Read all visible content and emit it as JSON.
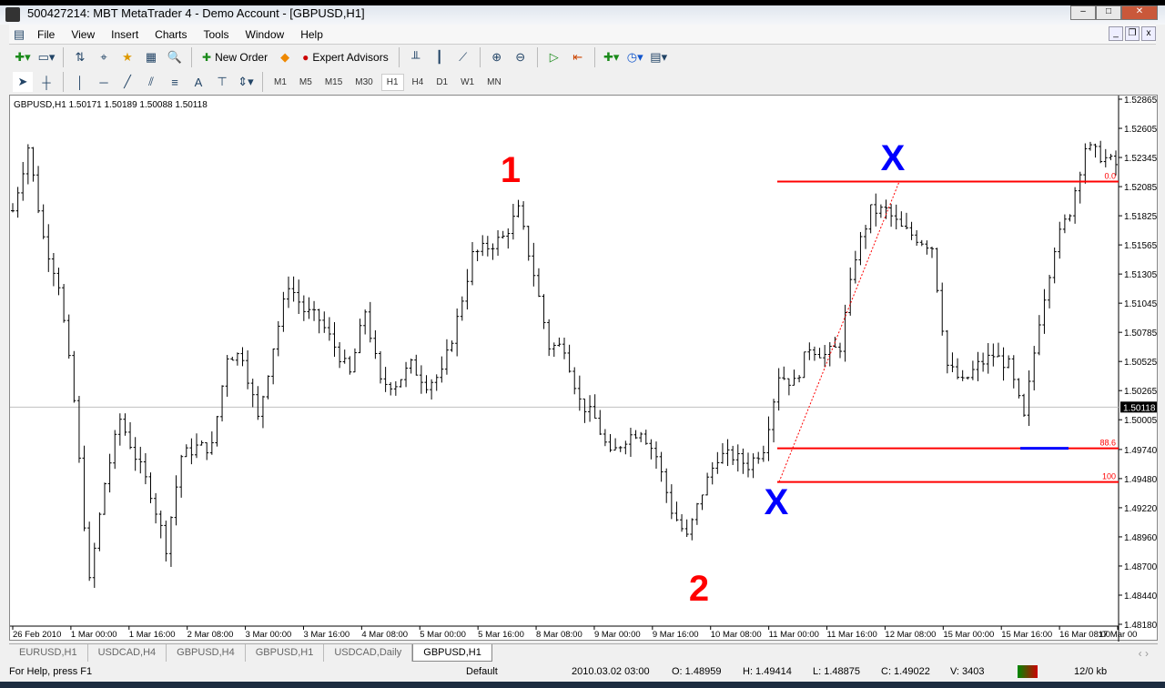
{
  "window": {
    "title": "500427214: MBT MetaTrader 4 - Demo Account - [GBPUSD,H1]"
  },
  "menu": [
    "File",
    "View",
    "Insert",
    "Charts",
    "Tools",
    "Window",
    "Help"
  ],
  "toolbar": {
    "new_order": "New Order",
    "expert_advisors": "Expert Advisors"
  },
  "drawing_tools": {
    "text_label": "A"
  },
  "timeframes": [
    "M1",
    "M5",
    "M15",
    "M30",
    "H1",
    "H4",
    "D1",
    "W1",
    "MN"
  ],
  "active_timeframe": "H1",
  "chart_data": {
    "type": "ohlc-bar",
    "header": "GBPUSD,H1  1.50171 1.50189 1.50088 1.50118",
    "current_price": "1.50118",
    "y_ticks": [
      "1.52865",
      "1.52605",
      "1.52345",
      "1.52085",
      "1.51825",
      "1.51565",
      "1.51305",
      "1.51045",
      "1.50785",
      "1.50525",
      "1.50265",
      "1.50005",
      "1.49740",
      "1.49480",
      "1.49220",
      "1.48960",
      "1.48700",
      "1.48440",
      "1.48180"
    ],
    "ylim": [
      1.4818,
      1.52865
    ],
    "x_ticks": [
      "26 Feb 2010",
      "1 Mar 00:00",
      "1 Mar 16:00",
      "2 Mar 08:00",
      "3 Mar 00:00",
      "3 Mar 16:00",
      "4 Mar 08:00",
      "5 Mar 00:00",
      "5 Mar 16:00",
      "8 Mar 08:00",
      "9 Mar 00:00",
      "9 Mar 16:00",
      "10 Mar 08:00",
      "11 Mar 00:00",
      "11 Mar 16:00",
      "12 Mar 08:00",
      "15 Mar 00:00",
      "15 Mar 16:00",
      "16 Mar 08:00",
      "17 Mar 00"
    ],
    "closes": [
      1.5187,
      1.5244,
      1.5163,
      1.5122,
      1.5017,
      1.4855,
      1.4944,
      1.5001,
      1.4968,
      1.4936,
      1.4887,
      1.4968,
      1.4976,
      1.4976,
      1.5058,
      1.5058,
      1.5001,
      1.5066,
      1.5122,
      1.5098,
      1.509,
      1.5066,
      1.5041,
      1.5098,
      1.5033,
      1.5033,
      1.5049,
      1.5033,
      1.5041,
      1.509,
      1.5147,
      1.5155,
      1.5163,
      1.5187,
      1.5131,
      1.5066,
      1.5066,
      1.5017,
      1.5001,
      1.4968,
      1.4984,
      1.4992,
      1.4968,
      1.492,
      1.4895,
      1.4936,
      1.4968,
      1.4968,
      1.496,
      1.4976,
      1.5041,
      1.5033,
      1.5066,
      1.5058,
      1.5066,
      1.5147,
      1.5187,
      1.5187,
      1.5171,
      1.5163,
      1.5155,
      1.5049,
      1.5033,
      1.5049,
      1.5058,
      1.5049,
      1.5001,
      1.509,
      1.5155,
      1.5187,
      1.5244,
      1.5236,
      1.5228
    ],
    "fib_levels": [
      {
        "label": "0.0",
        "price": 1.5213
      },
      {
        "label": "88.6",
        "price": 1.4975
      },
      {
        "label": "100",
        "price": 1.4945
      }
    ],
    "annotations": [
      {
        "text": "1",
        "color": "#ff0000"
      },
      {
        "text": "2",
        "color": "#ff0000"
      },
      {
        "text": "X",
        "color": "#0000ff"
      },
      {
        "text": "X",
        "color": "#0000ff"
      }
    ],
    "colors": {
      "bars": "#000000",
      "fib": "#ff0000",
      "marker": "#0000ff"
    }
  },
  "tabs": [
    "EURUSD,H1",
    "USDCAD,H4",
    "GBPUSD,H4",
    "GBPUSD,H1",
    "USDCAD,Daily",
    "GBPUSD,H1"
  ],
  "status": {
    "help": "For Help, press F1",
    "profile": "Default",
    "time": "2010.03.02 03:00",
    "open": "O: 1.48959",
    "high": "H: 1.49414",
    "low": "L: 1.48875",
    "close": "C: 1.49022",
    "volume": "V: 3403",
    "traffic": "12/0 kb"
  }
}
